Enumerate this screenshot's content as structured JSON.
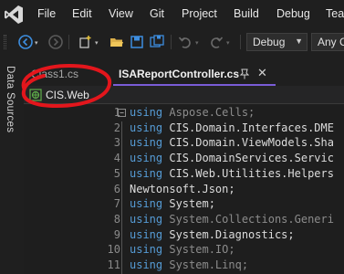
{
  "menu": {
    "items": [
      "File",
      "Edit",
      "View",
      "Git",
      "Project",
      "Build",
      "Debug",
      "Tea"
    ]
  },
  "toolbar": {
    "configuration": "Debug",
    "platform": "Any C"
  },
  "side_panel": {
    "label": "Data Sources"
  },
  "tabs": {
    "inactive_label": "Class1.cs",
    "active_label": "ISAReportController.cs"
  },
  "nav": {
    "project": "CIS.Web"
  },
  "editor": {
    "lines": [
      {
        "num": "1",
        "kw": "using",
        "rest": " Aspose.Cells;",
        "dim": true
      },
      {
        "num": "2",
        "kw": "using",
        "rest": " CIS.Domain.Interfaces.DME",
        "dim": false
      },
      {
        "num": "3",
        "kw": "using",
        "rest": " CIS.Domain.ViewModels.Sha",
        "dim": false
      },
      {
        "num": "4",
        "kw": "using",
        "rest": " CIS.DomainServices.Servic",
        "dim": false
      },
      {
        "num": "5",
        "kw": "using",
        "rest": " CIS.Web.Utilities.Helpers",
        "dim": false
      },
      {
        "num": "6",
        "kw": "",
        "rest": "Newtonsoft.Json;",
        "dim": false
      },
      {
        "num": "7",
        "kw": "using",
        "rest": " System;",
        "dim": false
      },
      {
        "num": "8",
        "kw": "using",
        "rest": " System.Collections.Generi",
        "dim": true
      },
      {
        "num": "9",
        "kw": "using",
        "rest": " System.Diagnostics;",
        "dim": false
      },
      {
        "num": "10",
        "kw": "using",
        "rest": " System.IO;",
        "dim": true
      },
      {
        "num": "11",
        "kw": "using",
        "rest": " System.Linq;",
        "dim": true
      }
    ]
  },
  "colors": {
    "accent": "#7a5cd6",
    "keyword": "#569cd6",
    "annotation": "#e3161c"
  },
  "icons": [
    "vs-logo-icon",
    "back-icon",
    "forward-icon",
    "new-item-icon",
    "open-folder-icon",
    "save-icon",
    "save-all-icon",
    "undo-icon",
    "redo-icon",
    "pin-icon",
    "close-icon",
    "project-icon",
    "collapse-icon"
  ]
}
